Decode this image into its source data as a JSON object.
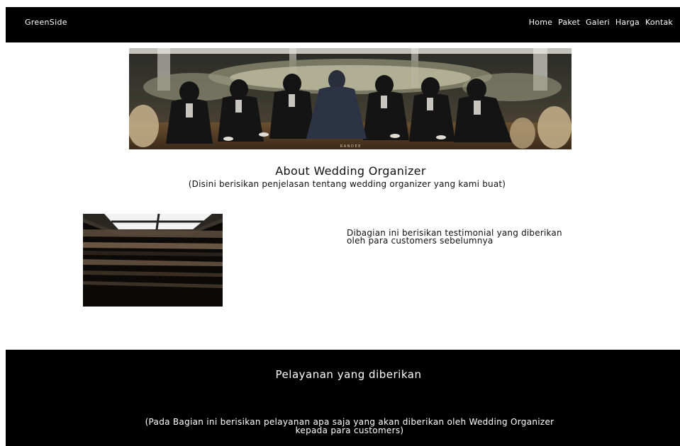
{
  "navbar": {
    "brand": "GreenSide",
    "links": [
      "Home",
      "Paket",
      "Galeri",
      "Harga",
      "Kontak"
    ]
  },
  "hero": {
    "watermark": "R A N D E E"
  },
  "about": {
    "title": "About Wedding Organizer",
    "subtitle": "(Disini berisikan penjelasan tentang wedding organizer yang kami buat)"
  },
  "testimonial": {
    "text": "Dibagian ini berisikan testimonial yang diberikan oleh para customers sebelumnya"
  },
  "services": {
    "title": "Pelayanan yang diberikan",
    "description": "(Pada Bagian ini berisikan pelayanan apa saja yang akan diberikan oleh Wedding Organizer kepada para customers)"
  },
  "colors": {
    "navbar_bg": "#000000",
    "page_bg": "#ffffff",
    "text_dark": "#111111",
    "text_light": "#ffffff"
  }
}
